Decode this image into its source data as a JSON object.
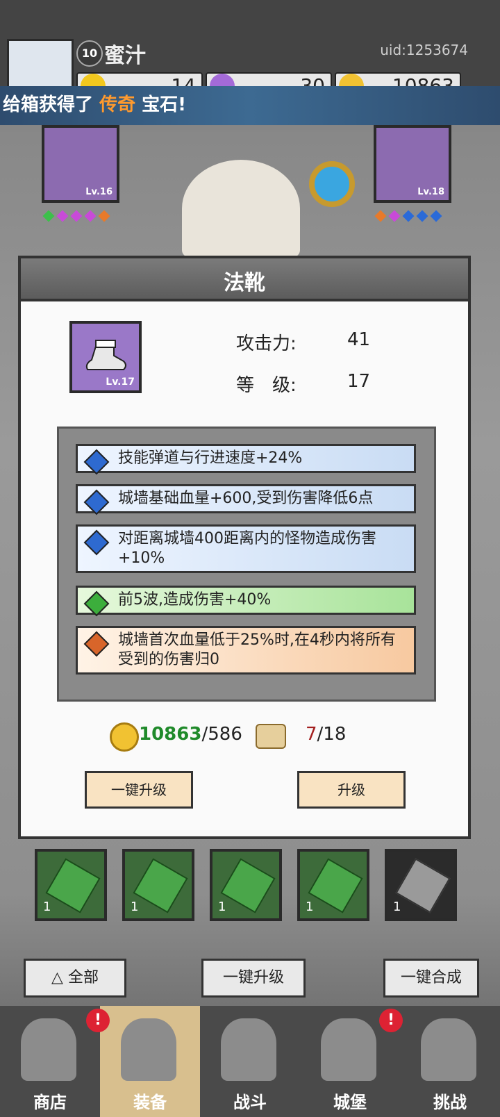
{
  "player": {
    "level": "10",
    "name": "蜜汁",
    "uid": "uid:1253674"
  },
  "resources": {
    "gems_yellow": "14",
    "gems_purple": "30",
    "coins": "10863"
  },
  "banner": {
    "prefix": "给箱获得了 ",
    "highlight": "传奇",
    "suffix": " 宝石!"
  },
  "equip_slots": {
    "left_top_lv": "Lv.16",
    "right_top_lv": "Lv.18"
  },
  "modal": {
    "title": "法靴",
    "item_lv": "Lv.17",
    "attack_label": "攻击力:",
    "attack_value": "41",
    "level_label": "等　级:",
    "level_value": "17",
    "affixes": [
      {
        "text": "技能弹道与行进速度+24%",
        "color": "blue"
      },
      {
        "text": "城墙基础血量+600,受到伤害降低6点",
        "color": "blue"
      },
      {
        "text": "对距离城墙400距离内的怪物造成伤害+10%",
        "color": "blue"
      },
      {
        "text": "前5波,造成伤害+40%",
        "color": "green"
      },
      {
        "text": "城墙首次血量低于25%时,在4秒内将所有受到的伤害归0",
        "color": "orange"
      }
    ],
    "coin_have": "10863",
    "coin_need": "/586",
    "scroll_have": "7",
    "scroll_need": "/18",
    "btn_one_key": "一键升级",
    "btn_upgrade": "升级"
  },
  "inventory": [
    {
      "count": "1",
      "type": "green"
    },
    {
      "count": "1",
      "type": "green"
    },
    {
      "count": "1",
      "type": "green"
    },
    {
      "count": "1",
      "type": "green"
    },
    {
      "count": "1",
      "type": "gray"
    }
  ],
  "actions": {
    "all": "全部",
    "upgrade_all": "一键升级",
    "merge_all": "一键合成"
  },
  "nav": {
    "shop": "商店",
    "equip": "装备",
    "battle": "战斗",
    "castle": "城堡",
    "challenge": "挑战"
  },
  "alert_mark": "!"
}
